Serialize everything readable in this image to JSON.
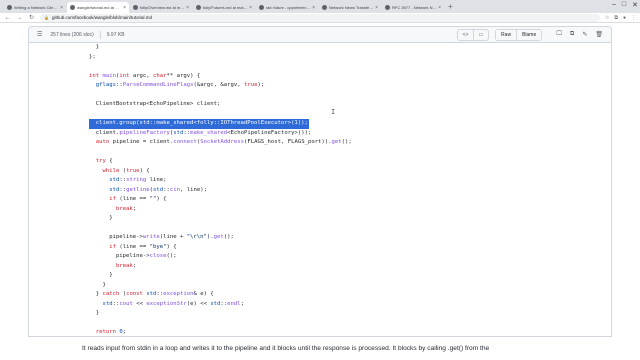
{
  "browser": {
    "tabs": [
      {
        "title": "Writing a Network Client with Facebook",
        "active": false
      },
      {
        "title": "wangle/tutorial.md at main · facebook",
        "active": true
      },
      {
        "title": "folly/Overview.md at main · facebook",
        "active": false
      },
      {
        "title": "folly/Futures.md at main · facebook",
        "active": false
      },
      {
        "title": "std::future - cppreference.com",
        "active": false
      },
      {
        "title": "Network News Transfer Protocol - Wiki",
        "active": false
      },
      {
        "title": "RFC 3977 - Network News Transfer",
        "active": false
      }
    ],
    "new_tab_glyph": "+",
    "url": "github.com/facebook/wangle/blob/main/tutorial.md"
  },
  "file_header": {
    "lines_info": "257 lines (206 sloc)",
    "size": "9.97 KB",
    "code_toggle": "<>",
    "preview_toggle": "▭",
    "raw_label": "Raw",
    "blame_label": "Blame"
  },
  "code": {
    "highlight_line": 8,
    "lines": [
      "  }",
      "};",
      "",
      "int main(int argc, char** argv) {",
      "  gflags::ParseCommandLineFlags(&argc, &argv, true);",
      "",
      "  ClientBootstrap<EchoPipeline> client;",
      "",
      "  client.group(std::make_shared<folly::IOThreadPoolExecutor>(1));",
      "  client.pipelineFactory(std::make_shared<EchoPipelineFactory>());",
      "  auto pipeline = client.connect(SocketAddress(FLAGS_host, FLAGS_port)).get();",
      "",
      "  try {",
      "    while (true) {",
      "      std::string line;",
      "      std::getline(std::cin, line);",
      "      if (line == \"\") {",
      "        break;",
      "      }",
      "",
      "      pipeline->write(line + \"\\r\\n\").get();",
      "      if (line == \"bye\") {",
      "        pipeline->close();",
      "        break;",
      "      }",
      "    }",
      "  } catch (const std::exception& e) {",
      "    std::cout << exceptionStr(e) << std::endl;",
      "  }",
      "",
      "  return 0;",
      "}"
    ]
  },
  "prose": "It reads input from stdin in a loop and writes it to the pipeline and it blocks until the response is processed. It blocks by calling .get() from the"
}
